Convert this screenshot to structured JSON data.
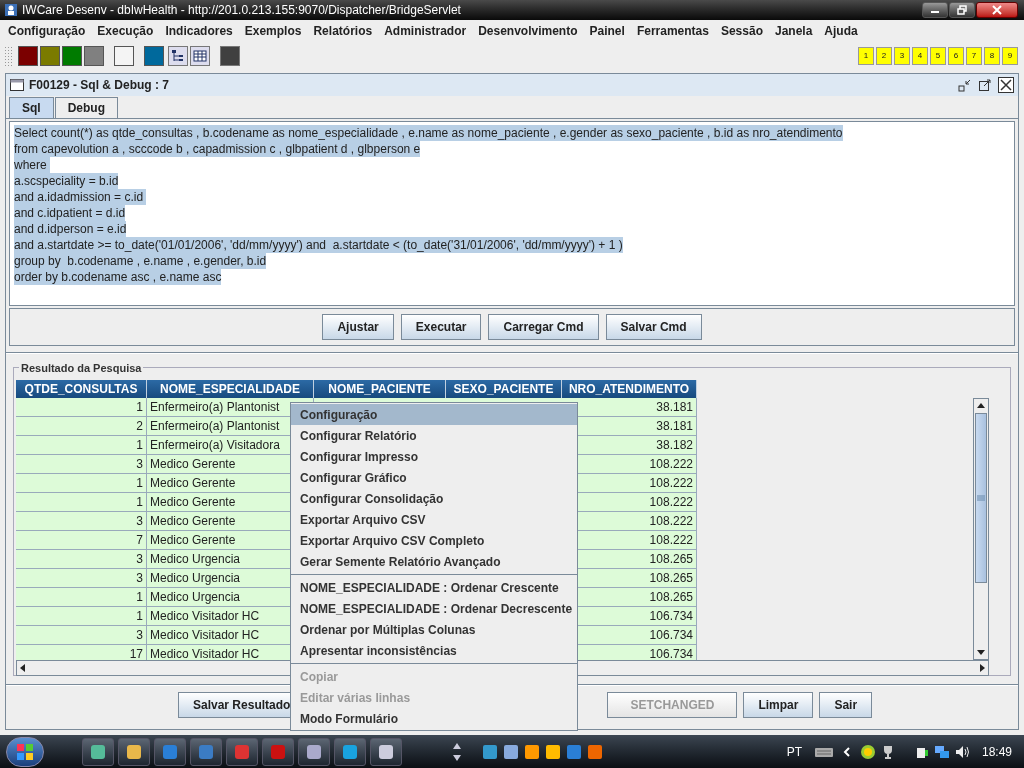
{
  "window": {
    "title": "IWCare Desenv - dbIwHealth - http://201.0.213.155:9070/Dispatcher/BridgeServlet"
  },
  "menu_bar": [
    "Configuração",
    "Execução",
    "Indicadores",
    "Exemplos",
    "Relatórios",
    "Administrador",
    "Desenvolvimento",
    "Painel",
    "Ferramentas",
    "Sessão",
    "Janela",
    "Ajuda"
  ],
  "toolbar": {
    "swatches": [
      {
        "color": "#7b0000"
      },
      {
        "color": "#7b7b00"
      },
      {
        "color": "#007b00"
      },
      {
        "color": "#808080"
      },
      {
        "color": "#f4f4f4"
      },
      {
        "color": "#00699c"
      }
    ],
    "numbers": [
      "1",
      "2",
      "3",
      "4",
      "5",
      "6",
      "7",
      "8",
      "9"
    ]
  },
  "frame": {
    "title": "F00129 - Sql & Debug : 7",
    "tabs": [
      {
        "label": "Sql",
        "selected": true
      },
      {
        "label": "Debug",
        "selected": false
      }
    ],
    "sql_editor": {
      "selected": true,
      "lines": [
        "Select count(*) as qtde_consultas , b.codename as nome_especialidade , e.name as nome_paciente , e.gender as sexo_paciente , b.id as nro_atendimento",
        "from capevolution a , scccode b , capadmission c , glbpatient d , glbperson e",
        "where ",
        "a.scspeciality = b.id",
        "and a.idadmission = c.id ",
        "and c.idpatient = d.id",
        "and d.idperson = e.id",
        "and a.startdate >= to_date('01/01/2006', 'dd/mm/yyyy') and  a.startdate < (to_date('31/01/2006', 'dd/mm/yyyy') + 1 )",
        "group by  b.codename , e.name , e.gender, b.id",
        "order by b.codename asc , e.name asc"
      ]
    },
    "editor_buttons": [
      "Ajustar",
      "Executar",
      "Carregar Cmd",
      "Salvar Cmd"
    ],
    "results": {
      "title": "Resultado da Pesquisa",
      "columns": [
        "QTDE_CONSULTAS",
        "NOME_ESPECIALIDADE",
        "NOME_PACIENTE",
        "SEXO_PACIENTE",
        "NRO_ATENDIMENTO"
      ],
      "rows": [
        [
          "1",
          "Enfermeiro(a) Plantonist",
          "38.181"
        ],
        [
          "2",
          "Enfermeiro(a) Plantonist",
          "38.181"
        ],
        [
          "1",
          "Enfermeiro(a) Visitadora",
          "38.182"
        ],
        [
          "3",
          "Medico Gerente",
          "108.222"
        ],
        [
          "1",
          "Medico Gerente",
          "108.222"
        ],
        [
          "1",
          "Medico Gerente",
          "108.222"
        ],
        [
          "3",
          "Medico Gerente",
          "108.222"
        ],
        [
          "7",
          "Medico Gerente",
          "108.222"
        ],
        [
          "3",
          "Medico Urgencia",
          "108.265"
        ],
        [
          "3",
          "Medico Urgencia",
          "108.265"
        ],
        [
          "1",
          "Medico Urgencia",
          "108.265"
        ],
        [
          "1",
          "Medico Visitador HC",
          "106.734"
        ],
        [
          "3",
          "Medico Visitador HC",
          "106.734"
        ],
        [
          "17",
          "Medico Visitador HC",
          "106.734"
        ]
      ]
    },
    "bottom_buttons": [
      {
        "label": "Salvar Resultado",
        "disabled": false
      },
      {
        "label": "SETCHANGED",
        "disabled": true
      },
      {
        "label": "Limpar",
        "disabled": false
      },
      {
        "label": "Sair",
        "disabled": false
      }
    ]
  },
  "context_menu": [
    {
      "kind": "item",
      "label": "Configuração",
      "selected": true,
      "disabled": false
    },
    {
      "kind": "item",
      "label": "Configurar Relatório",
      "selected": false,
      "disabled": false
    },
    {
      "kind": "item",
      "label": "Configurar Impresso",
      "selected": false,
      "disabled": false
    },
    {
      "kind": "item",
      "label": "Configurar Gráfico",
      "selected": false,
      "disabled": false
    },
    {
      "kind": "item",
      "label": "Configurar Consolidação",
      "selected": false,
      "disabled": false
    },
    {
      "kind": "item",
      "label": "Exportar Arquivo CSV",
      "selected": false,
      "disabled": false
    },
    {
      "kind": "item",
      "label": "Exportar Arquivo CSV Completo",
      "selected": false,
      "disabled": false
    },
    {
      "kind": "item",
      "label": "Gerar Semente Relatório Avançado",
      "selected": false,
      "disabled": false
    },
    {
      "kind": "separator"
    },
    {
      "kind": "item",
      "label": "NOME_ESPECIALIDADE : Ordenar Crescente",
      "selected": false,
      "disabled": false
    },
    {
      "kind": "item",
      "label": "NOME_ESPECIALIDADE : Ordenar Decrescente",
      "selected": false,
      "disabled": false
    },
    {
      "kind": "item",
      "label": "Ordenar por Múltiplas Colunas",
      "selected": false,
      "disabled": false
    },
    {
      "kind": "item",
      "label": "Apresentar inconsistências",
      "selected": false,
      "disabled": false
    },
    {
      "kind": "separator"
    },
    {
      "kind": "item",
      "label": "Copiar",
      "selected": false,
      "disabled": true
    },
    {
      "kind": "item",
      "label": "Editar várias linhas",
      "selected": false,
      "disabled": true
    },
    {
      "kind": "item",
      "label": "Modo Formulário",
      "selected": false,
      "disabled": false
    }
  ],
  "taskbar": {
    "language": "PT",
    "clock": "18:49"
  }
}
